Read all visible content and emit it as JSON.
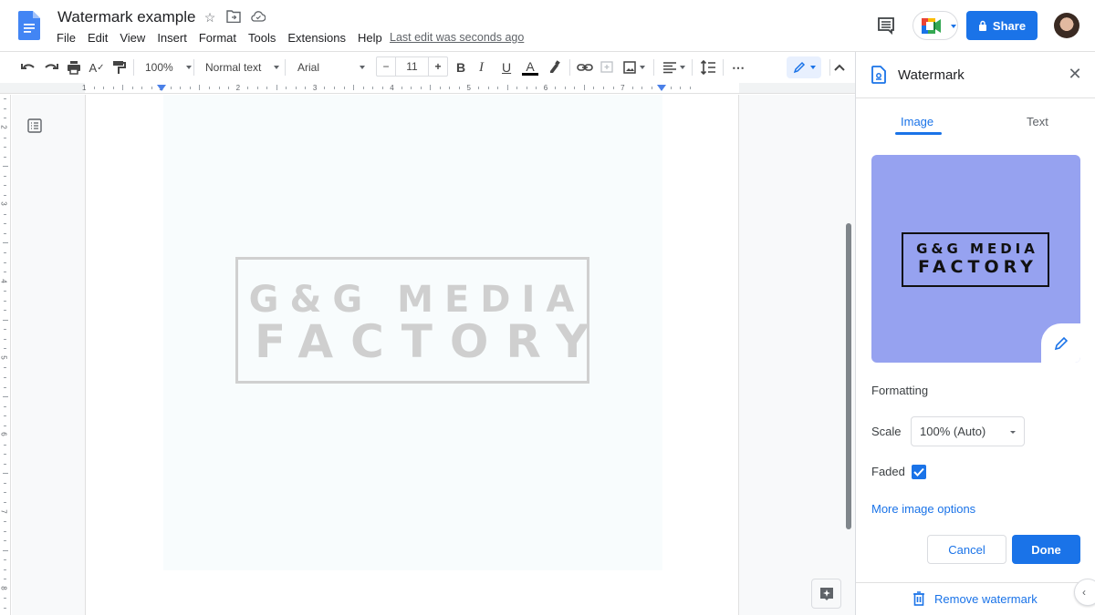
{
  "app": {
    "doc_title": "Watermark example",
    "title_icons": [
      "star-icon",
      "move-to-folder-icon",
      "cloud-status-icon"
    ],
    "menu": [
      "File",
      "Edit",
      "View",
      "Insert",
      "Format",
      "Tools",
      "Extensions",
      "Help"
    ],
    "last_edit": "Last edit was seconds ago",
    "share_label": "Share",
    "top_progress_fraction": 0.2
  },
  "toolbar": {
    "zoom": "100%",
    "style": "Normal text",
    "font": "Arial",
    "font_size": "11",
    "minus": "−",
    "plus": "+",
    "bold": "B",
    "italic": "I",
    "underline": "U",
    "text_color": "A",
    "more": "⋯",
    "text_color_value": "#000000"
  },
  "ruler": {
    "numbers": [
      "1",
      "1",
      "2",
      "3",
      "4",
      "5",
      "6",
      "7"
    ],
    "vertical_numbers": [
      "2",
      "3",
      "4",
      "5",
      "6",
      "7",
      "8"
    ]
  },
  "document": {
    "watermark_line1": "G&G MEDIA",
    "watermark_line2": "FACTORY"
  },
  "panel": {
    "title": "Watermark",
    "tabs": [
      {
        "label": "Image",
        "active": true
      },
      {
        "label": "Text",
        "active": false
      }
    ],
    "preview": {
      "line1": "G&G MEDIA",
      "line2": "FACTORY",
      "background": "#96a2f0"
    },
    "formatting_label": "Formatting",
    "scale_label": "Scale",
    "scale_value": "100% (Auto)",
    "faded_label": "Faded",
    "faded_checked": true,
    "more_options": "More image options",
    "cancel": "Cancel",
    "done": "Done",
    "remove": "Remove watermark"
  },
  "colors": {
    "accent": "#1a73e8",
    "watermark_gray": "#cfcfcf"
  }
}
